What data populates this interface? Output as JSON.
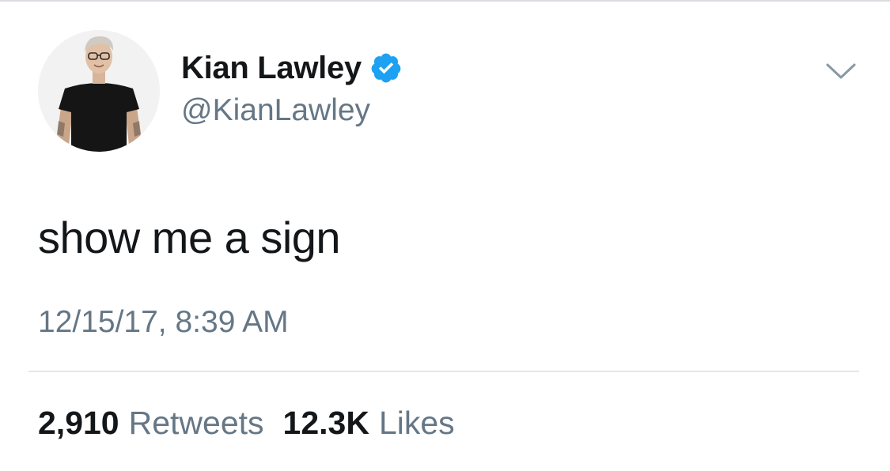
{
  "user": {
    "display_name": "Kian Lawley",
    "handle": "@KianLawley",
    "verified": true
  },
  "tweet": {
    "text": "show me a sign",
    "timestamp": "12/15/17, 8:39 AM"
  },
  "stats": {
    "retweets_count": "2,910",
    "retweets_label": "Retweets",
    "likes_count": "12.3K",
    "likes_label": "Likes"
  },
  "icons": {
    "verified": "verified-badge-icon",
    "menu": "chevron-down-icon"
  },
  "colors": {
    "verified_blue": "#1da1f2",
    "primary_text": "#14171a",
    "secondary_text": "#657786",
    "divider": "#e1e8ed"
  }
}
